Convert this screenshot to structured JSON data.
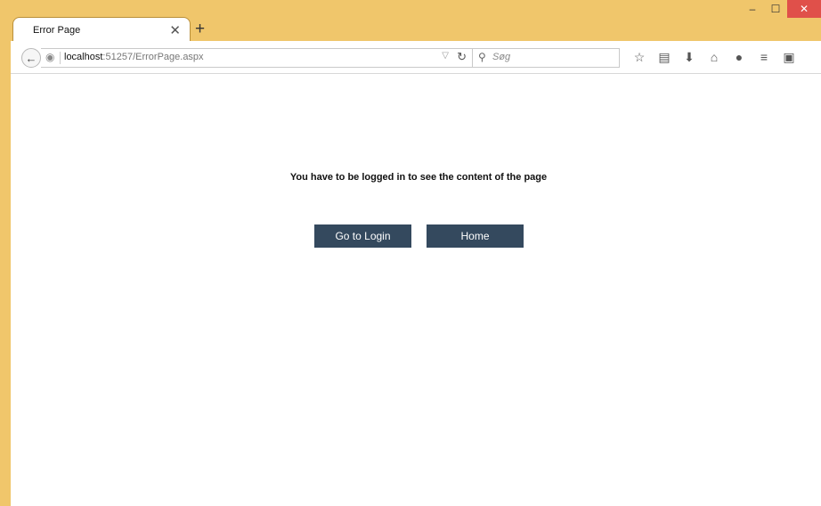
{
  "browser": {
    "tab_title": "Error Page",
    "new_tab": "+",
    "url_host": "localhost",
    "url_path": ":51257/ErrorPage.aspx",
    "search_placeholder": "Søg"
  },
  "page": {
    "message": "You have to be logged in to see the content of the page",
    "login_button": "Go to Login",
    "home_button": "Home"
  },
  "colors": {
    "frame": "#f0c66b",
    "button_bg": "#34495e",
    "close_btn": "#e0504a"
  }
}
